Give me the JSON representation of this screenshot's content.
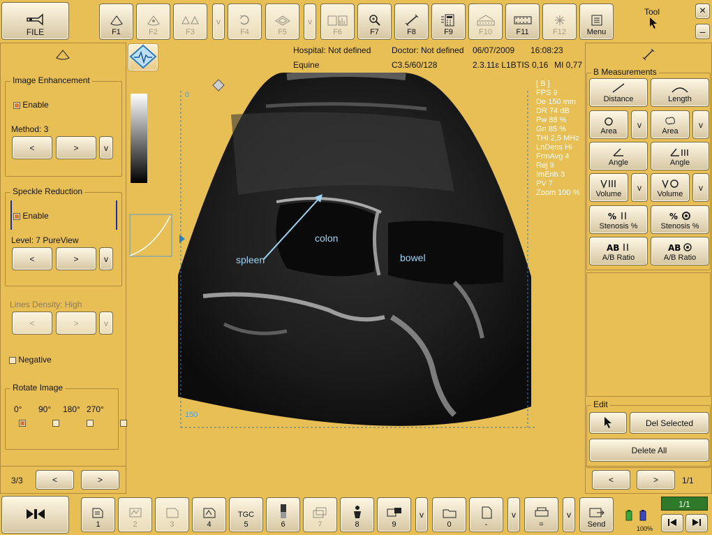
{
  "topbar": {
    "file_label": "FILE",
    "f_buttons": [
      "F1",
      "F2",
      "F3",
      "v",
      "F4",
      "F5",
      "v",
      "F6",
      "F7",
      "F8",
      "F9",
      "F10",
      "F11",
      "F12"
    ],
    "menu_label": "Menu",
    "tool_label": "Tool",
    "close_glyph": "×",
    "minimize_glyph": "–"
  },
  "info": {
    "hospital": "Hospital: Not defined",
    "doctor": "Doctor: Not defined",
    "date": "06/07/2009",
    "time": "16:08:23",
    "species": "Equine",
    "probe": "C3.5/60/128",
    "version": "2.3.11ɛ L1B",
    "tis": "TIS 0,16",
    "mi": "MI 0,77"
  },
  "left_panel": {
    "image_enhancement": {
      "title": "Image Enhancement",
      "enable": "Enable",
      "method": "Method: 3"
    },
    "speckle": {
      "title": "Speckle Reduction",
      "enable": "Enable",
      "level": "Level: 7 PureView"
    },
    "lines_density": "Lines Density: High",
    "negative": "Negative",
    "rotate": {
      "title": "Rotate Image",
      "options": [
        "0°",
        "90°",
        "180°",
        "270°"
      ]
    },
    "prev": "<",
    "next": ">",
    "more": "v",
    "page": "3/3"
  },
  "image": {
    "depth_top": "0",
    "depth_bottom": "150",
    "annotations": {
      "spleen": "spleen",
      "colon": "colon",
      "bowel": "bowel"
    },
    "params": [
      "[ B ]",
      "FPS  9",
      "De  150 mm",
      "DR  74 dB",
      "Pw  88 %",
      "Gn  85 %",
      "THI  2,5 MHz",
      "LnDens  Hi",
      "FrmAvg  4",
      "Rej  9",
      "ImEnh  3",
      "PV  7",
      "Zoom  100 %"
    ]
  },
  "right_panel": {
    "section": "B Measurements",
    "buttons": [
      "Distance",
      "Length",
      "Area",
      "Area",
      "Angle",
      "Angle",
      "Volume",
      "Volume",
      "Stenosis %",
      "Stenosis %",
      "A/B Ratio",
      "A/B Ratio"
    ],
    "dropdown": "v",
    "edit": {
      "title": "Edit",
      "del_selected": "Del Selected",
      "delete_all": "Delete All"
    },
    "prev": "<",
    "next": ">",
    "page": "1/1"
  },
  "bottombar": {
    "buttons": [
      "1",
      "2",
      "3",
      "4",
      "5",
      "6",
      "7",
      "8",
      "9",
      "v",
      "0",
      "-",
      "v",
      "=",
      "v",
      "Send"
    ],
    "tgc": "TGC",
    "battery": "100%",
    "counter": "1/1"
  },
  "colors": {
    "background": "#e8bf55",
    "accent_blue": "#2a7fc4",
    "counter_green": "#2f7a2a"
  }
}
